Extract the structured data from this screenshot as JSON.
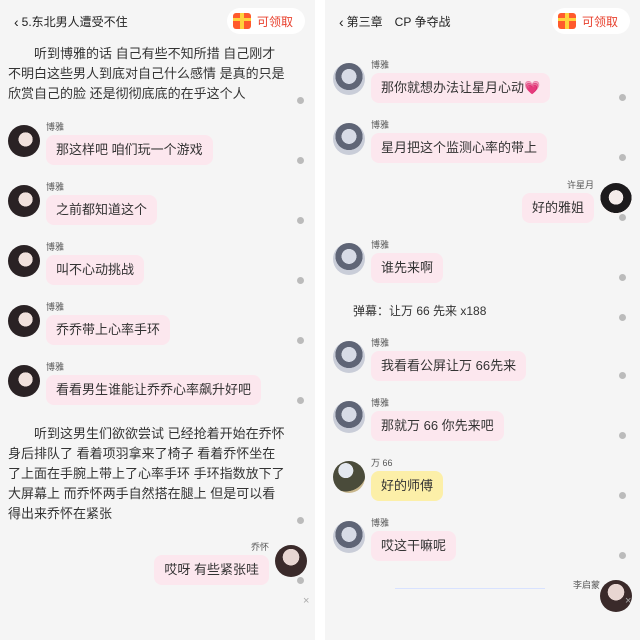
{
  "left": {
    "back_label": "5.东北男人遭受不住",
    "coupon_label": "可领取",
    "narration_1": "听到博雅的话 自己有些不知所措 自己刚才 不明白这些男人到底对自己什么感情 是真的只是欣赏自己的脸 还是彻彻底底的在乎这个人",
    "messages": [
      {
        "name": "博雅",
        "text": "那这样吧 咱们玩一个游戏"
      },
      {
        "name": "博雅",
        "text": "之前都知道这个"
      },
      {
        "name": "博雅",
        "text": "叫不心动挑战"
      },
      {
        "name": "博雅",
        "text": "乔乔带上心率手环"
      },
      {
        "name": "博雅",
        "text": "看看男生谁能让乔乔心率飙升好吧"
      }
    ],
    "narration_2": "听到这男生们欲欲尝试 已经抢着开始在乔怀身后排队了 看着项羽拿来了椅子 看着乔怀坐在了上面在手腕上带上了心率手环 手环指数放下了大屏幕上 而乔怀两手自然搭在腿上 但是可以看得出来乔怀在紧张",
    "self_message": {
      "name": "乔怀",
      "text": "哎呀 有些紧张哇"
    },
    "close_icon": "×"
  },
  "right": {
    "back_label": "第三章　CP 争夺战",
    "coupon_label": "可领取",
    "messages": [
      {
        "name": "博雅",
        "text": "那你就想办法让星月心动💗"
      },
      {
        "name": "博雅",
        "text": "星月把这个监测心率的带上"
      }
    ],
    "reply_1": {
      "name": "许星月",
      "text": "好的雅姐"
    },
    "messages_2": [
      {
        "name": "博雅",
        "text": "谁先来啊"
      }
    ],
    "danmu": "弹幕：让万 66 先来 x188",
    "messages_3": [
      {
        "name": "博雅",
        "text": "我看看公屏让万 66先来"
      },
      {
        "name": "博雅",
        "text": "那就万 66 你先来吧"
      }
    ],
    "wan_message": {
      "name": "万 66",
      "text": "好的师傅"
    },
    "messages_4": [
      {
        "name": "博雅",
        "text": "哎这干嘛呢"
      }
    ],
    "bottom_name": "李启蒙",
    "close_icon": "×"
  },
  "colors": {
    "pink_bubble": "#fce7ee",
    "yellow_bubble": "#fcefa8",
    "coupon_red": "#e8412e"
  },
  "icons": {
    "back": "chevron-left-icon",
    "coupon": "gift-icon",
    "close": "close-icon"
  }
}
